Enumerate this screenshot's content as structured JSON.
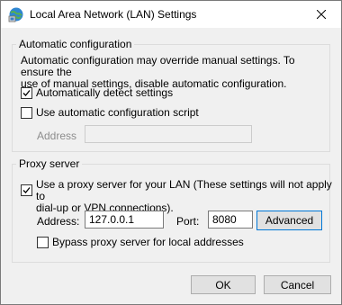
{
  "window": {
    "title": "Local Area Network (LAN) Settings",
    "close_icon": "close-icon",
    "app_icon": "network-settings-icon"
  },
  "auto_config": {
    "group_label": "Automatic configuration",
    "description_line1": "Automatic configuration may override manual settings.  To ensure the",
    "description_line2": "use of manual settings, disable automatic configuration.",
    "auto_detect": {
      "label": "Automatically detect settings",
      "checked": true
    },
    "auto_script": {
      "label": "Use automatic configuration script",
      "checked": false
    },
    "address_label": "Address",
    "address_value": ""
  },
  "proxy": {
    "group_label": "Proxy server",
    "use_proxy": {
      "label_line1": "Use a proxy server for your LAN (These settings will not apply to",
      "label_line2": "dial-up or VPN connections).",
      "checked": true
    },
    "address_label": "Address:",
    "address_value": "127.0.0.1",
    "port_label": "Port:",
    "port_value": "8080",
    "advanced_label": "Advanced",
    "bypass": {
      "label": "Bypass proxy server for local addresses",
      "checked": false
    }
  },
  "buttons": {
    "ok": "OK",
    "cancel": "Cancel"
  },
  "colors": {
    "accent": "#0078d7",
    "window_bg": "#f0f0f0",
    "title_bg": "#ffffff"
  }
}
